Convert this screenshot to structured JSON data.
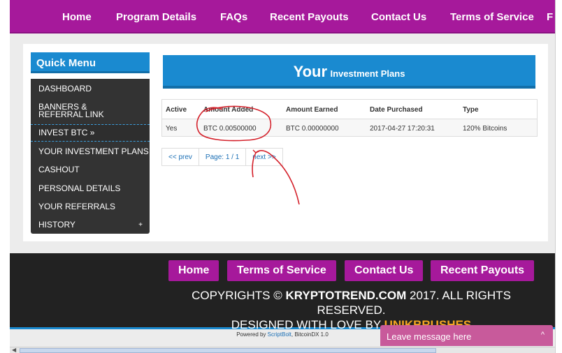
{
  "nav": {
    "items": [
      "Home",
      "Program Details",
      "FAQs",
      "Recent Payouts",
      "Contact Us",
      "Terms of Service",
      "F"
    ]
  },
  "quick_menu": {
    "title": "Quick Menu",
    "items": [
      "DASHBOARD",
      "BANNERS & REFERRAL LINK",
      "INVEST BTC »",
      "YOUR INVESTMENT PLANS",
      "CASHOUT",
      "PERSONAL DETAILS",
      "YOUR REFERRALS",
      "HISTORY"
    ],
    "history_expand": "+"
  },
  "plans": {
    "title_big": "Your",
    "title_small": "Investment Plans"
  },
  "table": {
    "headers": [
      "Active",
      "Amount Added",
      "Amount Earned",
      "Date Purchased",
      "Type"
    ],
    "rows": [
      [
        "Yes",
        "BTC 0.00500000",
        "BTC 0.00000000",
        "2017-04-27 17:20:31",
        "120% Bitcoins"
      ]
    ]
  },
  "pager": {
    "prev": "<< prev",
    "page": "Page: 1 / 1",
    "next": "next >>"
  },
  "footer": {
    "buttons": [
      "Home",
      "Terms of Service",
      "Contact Us",
      "Recent Payouts"
    ],
    "copy_prefix": "COPYRIGHTS © ",
    "copy_site": "KRYPTOTREND.COM",
    "copy_suffix": " 2017. ALL RIGHTS RESERVED.",
    "designed_prefix": "DESIGNED WITH LOVE BY ",
    "designed_brand": "UNIKBRUSHES",
    "powered_prefix": "Powered by ",
    "powered_link": "ScriptBolt",
    "powered_suffix": ", BitcoinDX 1.0"
  },
  "chat": {
    "label": "Leave message here",
    "chevron": "^"
  },
  "colors": {
    "nav_purple": "#a6199b",
    "accent_blue": "#1a8ad0",
    "menu_dark": "#333333",
    "annotation_red": "#d4202a",
    "brand_orange": "#f5a623",
    "chat_pink": "#c85a9b"
  }
}
